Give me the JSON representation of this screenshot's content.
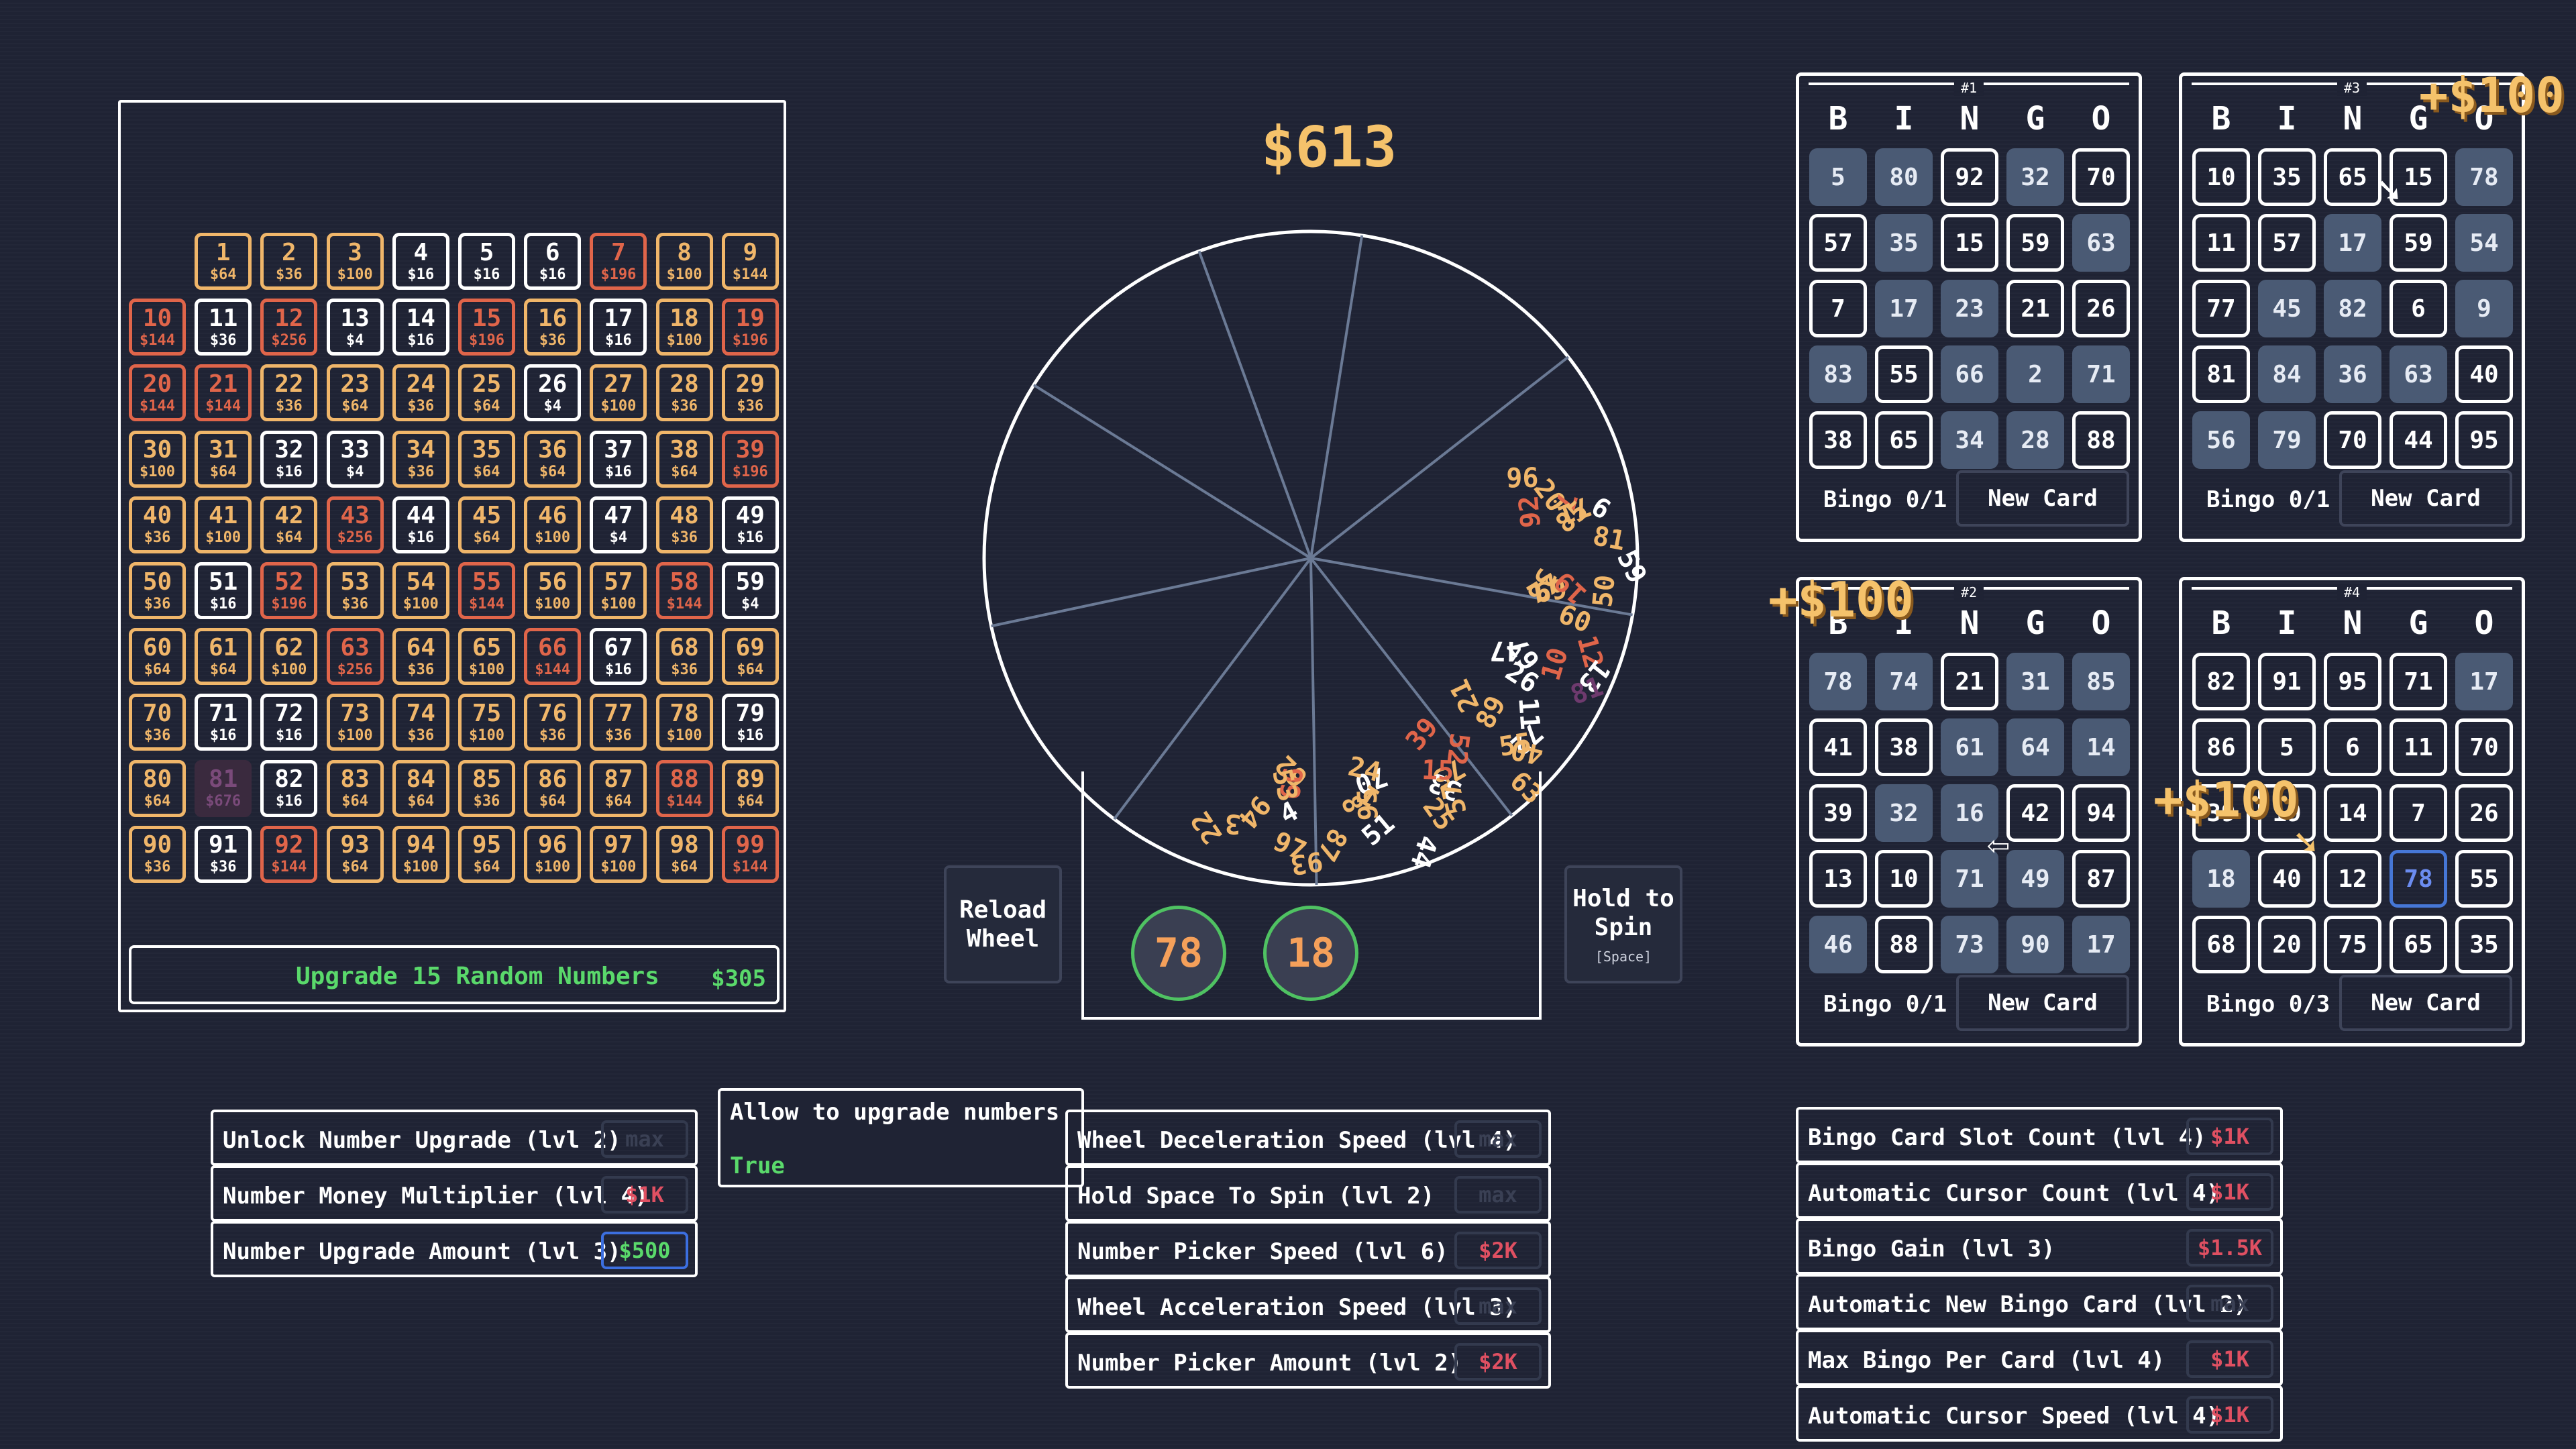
{
  "money": "$613",
  "grid": {
    "cells": [
      {
        "n": "1",
        "p": "$64",
        "c": "o"
      },
      {
        "n": "2",
        "p": "$36",
        "c": "o"
      },
      {
        "n": "3",
        "p": "$100",
        "c": "o"
      },
      {
        "n": "4",
        "p": "$16",
        "c": "w"
      },
      {
        "n": "5",
        "p": "$16",
        "c": "w"
      },
      {
        "n": "6",
        "p": "$16",
        "c": "w"
      },
      {
        "n": "7",
        "p": "$196",
        "c": "r"
      },
      {
        "n": "8",
        "p": "$100",
        "c": "o"
      },
      {
        "n": "9",
        "p": "$144",
        "c": "o"
      },
      {
        "n": "10",
        "p": "$144",
        "c": "r"
      },
      {
        "n": "11",
        "p": "$36",
        "c": "w"
      },
      {
        "n": "12",
        "p": "$256",
        "c": "r"
      },
      {
        "n": "13",
        "p": "$4",
        "c": "w"
      },
      {
        "n": "14",
        "p": "$16",
        "c": "w"
      },
      {
        "n": "15",
        "p": "$196",
        "c": "r"
      },
      {
        "n": "16",
        "p": "$36",
        "c": "o"
      },
      {
        "n": "17",
        "p": "$16",
        "c": "w"
      },
      {
        "n": "18",
        "p": "$100",
        "c": "o"
      },
      {
        "n": "19",
        "p": "$196",
        "c": "r"
      },
      {
        "n": "20",
        "p": "$144",
        "c": "r"
      },
      {
        "n": "21",
        "p": "$144",
        "c": "r"
      },
      {
        "n": "22",
        "p": "$36",
        "c": "o"
      },
      {
        "n": "23",
        "p": "$64",
        "c": "o"
      },
      {
        "n": "24",
        "p": "$36",
        "c": "o"
      },
      {
        "n": "25",
        "p": "$64",
        "c": "o"
      },
      {
        "n": "26",
        "p": "$4",
        "c": "w"
      },
      {
        "n": "27",
        "p": "$100",
        "c": "o"
      },
      {
        "n": "28",
        "p": "$36",
        "c": "o"
      },
      {
        "n": "29",
        "p": "$36",
        "c": "o"
      },
      {
        "n": "30",
        "p": "$100",
        "c": "o"
      },
      {
        "n": "31",
        "p": "$64",
        "c": "o"
      },
      {
        "n": "32",
        "p": "$16",
        "c": "w"
      },
      {
        "n": "33",
        "p": "$4",
        "c": "w"
      },
      {
        "n": "34",
        "p": "$36",
        "c": "o"
      },
      {
        "n": "35",
        "p": "$64",
        "c": "o"
      },
      {
        "n": "36",
        "p": "$64",
        "c": "o"
      },
      {
        "n": "37",
        "p": "$16",
        "c": "w"
      },
      {
        "n": "38",
        "p": "$64",
        "c": "o"
      },
      {
        "n": "39",
        "p": "$196",
        "c": "r"
      },
      {
        "n": "40",
        "p": "$36",
        "c": "o"
      },
      {
        "n": "41",
        "p": "$100",
        "c": "o"
      },
      {
        "n": "42",
        "p": "$64",
        "c": "o"
      },
      {
        "n": "43",
        "p": "$256",
        "c": "r"
      },
      {
        "n": "44",
        "p": "$16",
        "c": "w"
      },
      {
        "n": "45",
        "p": "$64",
        "c": "o"
      },
      {
        "n": "46",
        "p": "$100",
        "c": "o"
      },
      {
        "n": "47",
        "p": "$4",
        "c": "w"
      },
      {
        "n": "48",
        "p": "$36",
        "c": "o"
      },
      {
        "n": "49",
        "p": "$16",
        "c": "w"
      },
      {
        "n": "50",
        "p": "$36",
        "c": "o"
      },
      {
        "n": "51",
        "p": "$16",
        "c": "w"
      },
      {
        "n": "52",
        "p": "$196",
        "c": "r"
      },
      {
        "n": "53",
        "p": "$36",
        "c": "o"
      },
      {
        "n": "54",
        "p": "$100",
        "c": "o"
      },
      {
        "n": "55",
        "p": "$144",
        "c": "r"
      },
      {
        "n": "56",
        "p": "$100",
        "c": "o"
      },
      {
        "n": "57",
        "p": "$100",
        "c": "o"
      },
      {
        "n": "58",
        "p": "$144",
        "c": "r"
      },
      {
        "n": "59",
        "p": "$4",
        "c": "w"
      },
      {
        "n": "60",
        "p": "$64",
        "c": "o"
      },
      {
        "n": "61",
        "p": "$64",
        "c": "o"
      },
      {
        "n": "62",
        "p": "$100",
        "c": "o"
      },
      {
        "n": "63",
        "p": "$256",
        "c": "r"
      },
      {
        "n": "64",
        "p": "$36",
        "c": "o"
      },
      {
        "n": "65",
        "p": "$100",
        "c": "o"
      },
      {
        "n": "66",
        "p": "$144",
        "c": "r"
      },
      {
        "n": "67",
        "p": "$16",
        "c": "w"
      },
      {
        "n": "68",
        "p": "$36",
        "c": "o"
      },
      {
        "n": "69",
        "p": "$64",
        "c": "o"
      },
      {
        "n": "70",
        "p": "$36",
        "c": "o"
      },
      {
        "n": "71",
        "p": "$16",
        "c": "w"
      },
      {
        "n": "72",
        "p": "$16",
        "c": "w"
      },
      {
        "n": "73",
        "p": "$100",
        "c": "o"
      },
      {
        "n": "74",
        "p": "$36",
        "c": "o"
      },
      {
        "n": "75",
        "p": "$100",
        "c": "o"
      },
      {
        "n": "76",
        "p": "$36",
        "c": "o"
      },
      {
        "n": "77",
        "p": "$36",
        "c": "o"
      },
      {
        "n": "78",
        "p": "$100",
        "c": "o"
      },
      {
        "n": "79",
        "p": "$16",
        "c": "w"
      },
      {
        "n": "80",
        "p": "$64",
        "c": "o"
      },
      {
        "n": "81",
        "p": "$676",
        "c": "p"
      },
      {
        "n": "82",
        "p": "$16",
        "c": "w"
      },
      {
        "n": "83",
        "p": "$64",
        "c": "o"
      },
      {
        "n": "84",
        "p": "$64",
        "c": "o"
      },
      {
        "n": "85",
        "p": "$36",
        "c": "o"
      },
      {
        "n": "86",
        "p": "$64",
        "c": "o"
      },
      {
        "n": "87",
        "p": "$64",
        "c": "o"
      },
      {
        "n": "88",
        "p": "$144",
        "c": "r"
      },
      {
        "n": "89",
        "p": "$64",
        "c": "o"
      },
      {
        "n": "90",
        "p": "$36",
        "c": "o"
      },
      {
        "n": "91",
        "p": "$36",
        "c": "w"
      },
      {
        "n": "92",
        "p": "$144",
        "c": "r"
      },
      {
        "n": "93",
        "p": "$64",
        "c": "o"
      },
      {
        "n": "94",
        "p": "$100",
        "c": "o"
      },
      {
        "n": "95",
        "p": "$64",
        "c": "o"
      },
      {
        "n": "96",
        "p": "$100",
        "c": "o"
      },
      {
        "n": "97",
        "p": "$100",
        "c": "o"
      },
      {
        "n": "98",
        "p": "$64",
        "c": "o"
      },
      {
        "n": "99",
        "p": "$144",
        "c": "r"
      }
    ],
    "upgrade_label": "Upgrade 15 Random Numbers",
    "upgrade_cost": "$305"
  },
  "wheel": {
    "balls": [
      "78",
      "18"
    ],
    "reload_label": "Reload\nWheel",
    "spin_label": "Hold to\nSpin",
    "spin_hint": "[Space]",
    "floating_numbers": [
      {
        "t": "96",
        "c": "o"
      },
      {
        "t": "20",
        "c": "o"
      },
      {
        "t": "7",
        "c": "r"
      },
      {
        "t": "71",
        "c": "o"
      },
      {
        "t": "9",
        "c": "w"
      },
      {
        "t": "92",
        "c": "r"
      },
      {
        "t": "85",
        "c": "o"
      },
      {
        "t": "81",
        "c": "o"
      },
      {
        "t": "59",
        "c": "w"
      },
      {
        "t": "38",
        "c": "o"
      },
      {
        "t": "69",
        "c": "o"
      },
      {
        "t": "19",
        "c": "r"
      },
      {
        "t": "50",
        "c": "o"
      },
      {
        "t": "77",
        "c": "o"
      },
      {
        "t": "60",
        "c": "o"
      },
      {
        "t": "12",
        "c": "r"
      },
      {
        "t": "13",
        "c": "w"
      },
      {
        "t": "47",
        "c": "w"
      },
      {
        "t": "67",
        "c": "w"
      },
      {
        "t": "10",
        "c": "r"
      },
      {
        "t": "81",
        "c": "p"
      },
      {
        "t": "26",
        "c": "w"
      },
      {
        "t": "11",
        "c": "w"
      },
      {
        "t": "72",
        "c": "w"
      },
      {
        "t": "40",
        "c": "o"
      },
      {
        "t": "21",
        "c": "o"
      },
      {
        "t": "89",
        "c": "o"
      },
      {
        "t": "55",
        "c": "o"
      },
      {
        "t": "63",
        "c": "o"
      },
      {
        "t": "52",
        "c": "r"
      },
      {
        "t": "75",
        "c": "o"
      },
      {
        "t": "33",
        "c": "w"
      },
      {
        "t": "57",
        "c": "o"
      },
      {
        "t": "39",
        "c": "r"
      },
      {
        "t": "15",
        "c": "r"
      },
      {
        "t": "25",
        "c": "o"
      },
      {
        "t": "44",
        "c": "w"
      },
      {
        "t": "70",
        "c": "w"
      },
      {
        "t": "1",
        "c": "o"
      },
      {
        "t": "95",
        "c": "o"
      },
      {
        "t": "51",
        "c": "w"
      },
      {
        "t": "24",
        "c": "o"
      },
      {
        "t": "8",
        "c": "o"
      },
      {
        "t": "87",
        "c": "o"
      },
      {
        "t": "93",
        "c": "o"
      },
      {
        "t": "62",
        "c": "o"
      },
      {
        "t": "66",
        "c": "r"
      },
      {
        "t": "4",
        "c": "w"
      },
      {
        "t": "97",
        "c": "o"
      },
      {
        "t": "53",
        "c": "o"
      },
      {
        "t": "94",
        "c": "o"
      },
      {
        "t": "3",
        "c": "o"
      },
      {
        "t": "22",
        "c": "o"
      }
    ]
  },
  "cards": [
    {
      "id": "#1",
      "headers": [
        "B",
        "I",
        "N",
        "G",
        "O"
      ],
      "cells": [
        [
          "5",
          "h"
        ],
        [
          "80",
          "h"
        ],
        [
          "92",
          "o"
        ],
        [
          "32",
          "h"
        ],
        [
          "70",
          "o"
        ],
        [
          "57",
          "o"
        ],
        [
          "35",
          "h"
        ],
        [
          "15",
          "o"
        ],
        [
          "59",
          "o"
        ],
        [
          "63",
          "h"
        ],
        [
          "7",
          "o"
        ],
        [
          "17",
          "h"
        ],
        [
          "23",
          "h"
        ],
        [
          "21",
          "o"
        ],
        [
          "26",
          "o"
        ],
        [
          "83",
          "h"
        ],
        [
          "55",
          "o"
        ],
        [
          "66",
          "h"
        ],
        [
          "2",
          "h"
        ],
        [
          "71",
          "h"
        ],
        [
          "38",
          "o"
        ],
        [
          "65",
          "o"
        ],
        [
          "34",
          "h"
        ],
        [
          "28",
          "h"
        ],
        [
          "88",
          "o"
        ]
      ],
      "status": "Bingo 0/1",
      "new_card": "New Card"
    },
    {
      "id": "#3",
      "headers": [
        "B",
        "I",
        "N",
        "G",
        "O"
      ],
      "cells": [
        [
          "10",
          "o"
        ],
        [
          "35",
          "o"
        ],
        [
          "65",
          "o"
        ],
        [
          "15",
          "o"
        ],
        [
          "78",
          "h"
        ],
        [
          "11",
          "o"
        ],
        [
          "57",
          "o"
        ],
        [
          "17",
          "h"
        ],
        [
          "59",
          "o"
        ],
        [
          "54",
          "h"
        ],
        [
          "77",
          "o"
        ],
        [
          "45",
          "h"
        ],
        [
          "82",
          "h"
        ],
        [
          "6",
          "o"
        ],
        [
          "9",
          "h"
        ],
        [
          "81",
          "o"
        ],
        [
          "84",
          "h"
        ],
        [
          "36",
          "h"
        ],
        [
          "63",
          "h"
        ],
        [
          "40",
          "o"
        ],
        [
          "56",
          "h"
        ],
        [
          "79",
          "h"
        ],
        [
          "70",
          "o"
        ],
        [
          "44",
          "o"
        ],
        [
          "95",
          "o"
        ]
      ],
      "status": "Bingo 0/1",
      "new_card": "New Card"
    },
    {
      "id": "#2",
      "headers": [
        "B",
        "I",
        "N",
        "G",
        "O"
      ],
      "cells": [
        [
          "78",
          "h"
        ],
        [
          "74",
          "h"
        ],
        [
          "21",
          "o"
        ],
        [
          "31",
          "h"
        ],
        [
          "85",
          "h"
        ],
        [
          "41",
          "o"
        ],
        [
          "38",
          "o"
        ],
        [
          "61",
          "h"
        ],
        [
          "64",
          "h"
        ],
        [
          "14",
          "h"
        ],
        [
          "39",
          "o"
        ],
        [
          "32",
          "h"
        ],
        [
          "16",
          "h"
        ],
        [
          "42",
          "o"
        ],
        [
          "94",
          "o"
        ],
        [
          "13",
          "o"
        ],
        [
          "10",
          "o"
        ],
        [
          "71",
          "h"
        ],
        [
          "49",
          "h"
        ],
        [
          "87",
          "o"
        ],
        [
          "46",
          "h"
        ],
        [
          "88",
          "o"
        ],
        [
          "73",
          "h"
        ],
        [
          "90",
          "h"
        ],
        [
          "17",
          "h"
        ]
      ],
      "status": "Bingo 0/1",
      "new_card": "New Card"
    },
    {
      "id": "#4",
      "headers": [
        "B",
        "I",
        "N",
        "G",
        "O"
      ],
      "cells": [
        [
          "82",
          "o"
        ],
        [
          "91",
          "o"
        ],
        [
          "95",
          "o"
        ],
        [
          "71",
          "o"
        ],
        [
          "17",
          "h"
        ],
        [
          "86",
          "o"
        ],
        [
          "5",
          "o"
        ],
        [
          "6",
          "o"
        ],
        [
          "11",
          "o"
        ],
        [
          "70",
          "o"
        ],
        [
          "39",
          "o"
        ],
        [
          "19",
          "o"
        ],
        [
          "14",
          "o"
        ],
        [
          "7",
          "o"
        ],
        [
          "26",
          "o"
        ],
        [
          "18",
          "h"
        ],
        [
          "40",
          "o"
        ],
        [
          "12",
          "o"
        ],
        [
          "78",
          "c"
        ],
        [
          "55",
          "o"
        ],
        [
          "68",
          "o"
        ],
        [
          "20",
          "o"
        ],
        [
          "75",
          "o"
        ],
        [
          "65",
          "o"
        ],
        [
          "35",
          "o"
        ]
      ],
      "status": "Bingo 0/3",
      "new_card": "New Card"
    }
  ],
  "floating_money": [
    "+$100",
    "+$100",
    "+$100"
  ],
  "tooltip": {
    "title": "Allow to upgrade numbers",
    "value": "True"
  },
  "upgrades_left": [
    {
      "name": "Unlock Number Upgrade (lvl 2)",
      "cost": "max",
      "style": "max"
    },
    {
      "name": "Number Money Multiplier (lvl 4)",
      "cost": "$1K",
      "style": "red"
    },
    {
      "name": "Number Upgrade Amount (lvl 3)",
      "cost": "$500",
      "style": "green"
    }
  ],
  "upgrades_mid": [
    {
      "name": "Wheel Deceleration Speed (lvl 4)",
      "cost": "max",
      "style": "max"
    },
    {
      "name": "Hold Space To Spin (lvl 2)",
      "cost": "max",
      "style": "max"
    },
    {
      "name": "Number Picker Speed (lvl 6)",
      "cost": "$2K",
      "style": "red"
    },
    {
      "name": "Wheel Acceleration Speed (lvl 3)",
      "cost": "max",
      "style": "max"
    },
    {
      "name": "Number Picker Amount (lvl 2)",
      "cost": "$2K",
      "style": "red"
    }
  ],
  "upgrades_right": [
    {
      "name": "Bingo Card Slot Count (lvl 4)",
      "cost": "$1K",
      "style": "red"
    },
    {
      "name": "Automatic Cursor Count (lvl 4)",
      "cost": "$1K",
      "style": "red"
    },
    {
      "name": "Bingo Gain (lvl 3)",
      "cost": "$1.5K",
      "style": "red"
    },
    {
      "name": "Automatic New Bingo Card (lvl 2)",
      "cost": "max",
      "style": "max"
    },
    {
      "name": "Max Bingo Per Card (lvl 4)",
      "cost": "$1K",
      "style": "red"
    },
    {
      "name": "Automatic Cursor Speed (lvl 4)",
      "cost": "$1K",
      "style": "red"
    }
  ],
  "colors": {
    "orange": "#f0b66a",
    "red": "#e0654a",
    "white": "#ffffff",
    "purple": "#6e3a6e",
    "hit": "#4a5a74",
    "accent_green": "#5ad96b",
    "money": "#f5c26b"
  }
}
